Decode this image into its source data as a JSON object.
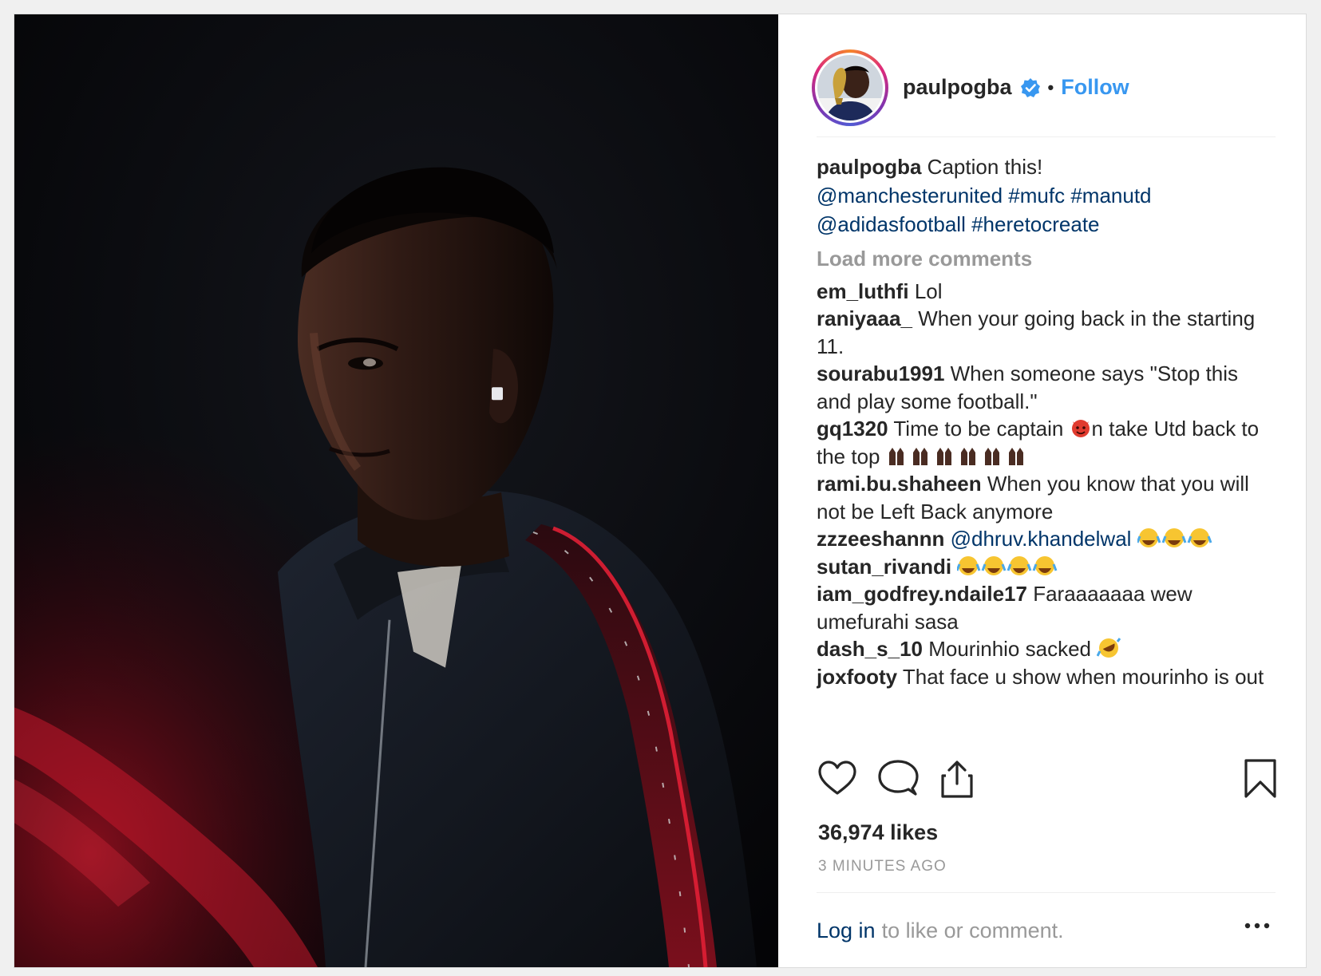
{
  "post": {
    "username": "paulpogba",
    "follow_label": "Follow",
    "separator": "•",
    "caption_user": "paulpogba",
    "caption_text": "Caption this!",
    "caption_line2": "@manchesterunited #mufc #manutd",
    "caption_line3": "@adidasfootball #heretocreate",
    "load_more": "Load more comments",
    "likes": "36,974 likes",
    "time": "3 MINUTES AGO",
    "login_label": "Log in",
    "login_rest": "to like or comment."
  },
  "comments": [
    {
      "user": "em_luthfi",
      "text": "Lol"
    },
    {
      "user": "raniyaaa_",
      "text": "When your going back in the starting 11."
    },
    {
      "user": "sourabu1991",
      "text": "When someone says \"Stop this and play some football.\""
    },
    {
      "user": "gq1320",
      "text_a": "Time to be captain",
      "text_b": "n take Utd back to the top"
    },
    {
      "user": "rami.bu.shaheen",
      "text": "When you know that you will not be Left Back anymore"
    },
    {
      "user": "zzzeeshannn",
      "text": "@dhruv.khandelwal"
    },
    {
      "user": "sutan_rivandi",
      "text": ""
    },
    {
      "user": "iam_godfrey.ndaile17",
      "text": "Faraaaaaaa wew umefurahi sasa"
    },
    {
      "user": "dash_s_10",
      "text": "Mourinhio sacked"
    },
    {
      "user": "joxfooty",
      "text": "That face u show when mourinho is out"
    }
  ],
  "icons": {
    "like": "heart-icon",
    "comment": "comment-icon",
    "share": "share-icon",
    "save": "bookmark-icon",
    "verified": "verified-badge-icon",
    "more": "more-options-icon"
  },
  "colors": {
    "link": "#003569",
    "follow": "#3897f0",
    "muted": "#999999",
    "verified": "#3897f0"
  }
}
